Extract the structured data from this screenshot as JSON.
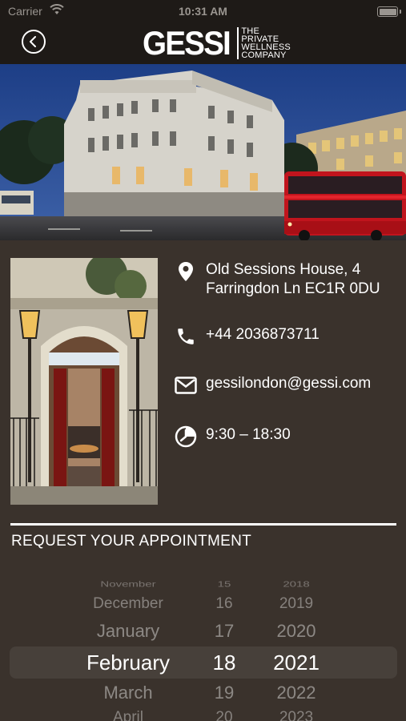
{
  "status_bar": {
    "carrier": "Carrier",
    "time": "10:31 AM"
  },
  "nav": {
    "logo_mark": "GESSI",
    "logo_lines": [
      "THE",
      "PRIVATE",
      "WELLNESS",
      "COMPANY"
    ]
  },
  "contact": {
    "address": "Old Sessions House, 4 Farringdon Ln EC1R 0DU",
    "phone": "+44 2036873711",
    "email": "gessilondon@gessi.com",
    "hours": "9:30 – 18:30"
  },
  "appointment": {
    "title": "REQUEST YOUR APPOINTMENT",
    "months": [
      "November",
      "December",
      "January",
      "February",
      "March",
      "April"
    ],
    "days": [
      "15",
      "16",
      "17",
      "18",
      "19",
      "20"
    ],
    "years": [
      "2018",
      "2019",
      "2020",
      "2021",
      "2022",
      "2023"
    ],
    "selected": {
      "month": "February",
      "day": "18",
      "year": "2021"
    }
  },
  "colors": {
    "background": "#3a322c",
    "nav": "#1e1a17",
    "accent": "#ffffff"
  }
}
